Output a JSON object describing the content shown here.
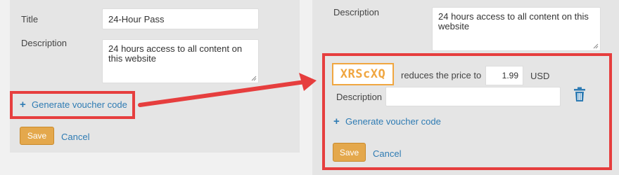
{
  "left": {
    "title_label": "Title",
    "title_value": "24-Hour Pass",
    "description_label": "Description",
    "description_value": "24 hours access to all content on this website",
    "generate_label": "Generate voucher code",
    "save_label": "Save",
    "cancel_label": "Cancel"
  },
  "right": {
    "description_label": "Description",
    "description_value": "24 hours access to all content on this website",
    "voucher": {
      "code": "XRScXQ",
      "reduces_text": "reduces the price to",
      "price": "1.99",
      "currency": "USD",
      "description_label": "Description",
      "description_value": ""
    },
    "generate_label": "Generate voucher code",
    "save_label": "Save",
    "cancel_label": "Cancel"
  },
  "colors": {
    "highlight": "#e63e3e",
    "accent_orange": "#f0a640",
    "link_blue": "#2e7bb3"
  },
  "icons": {
    "plus": "plus-icon",
    "trash": "trash-icon",
    "arrow": "arrow-icon",
    "resize": "resize-grip-icon"
  }
}
